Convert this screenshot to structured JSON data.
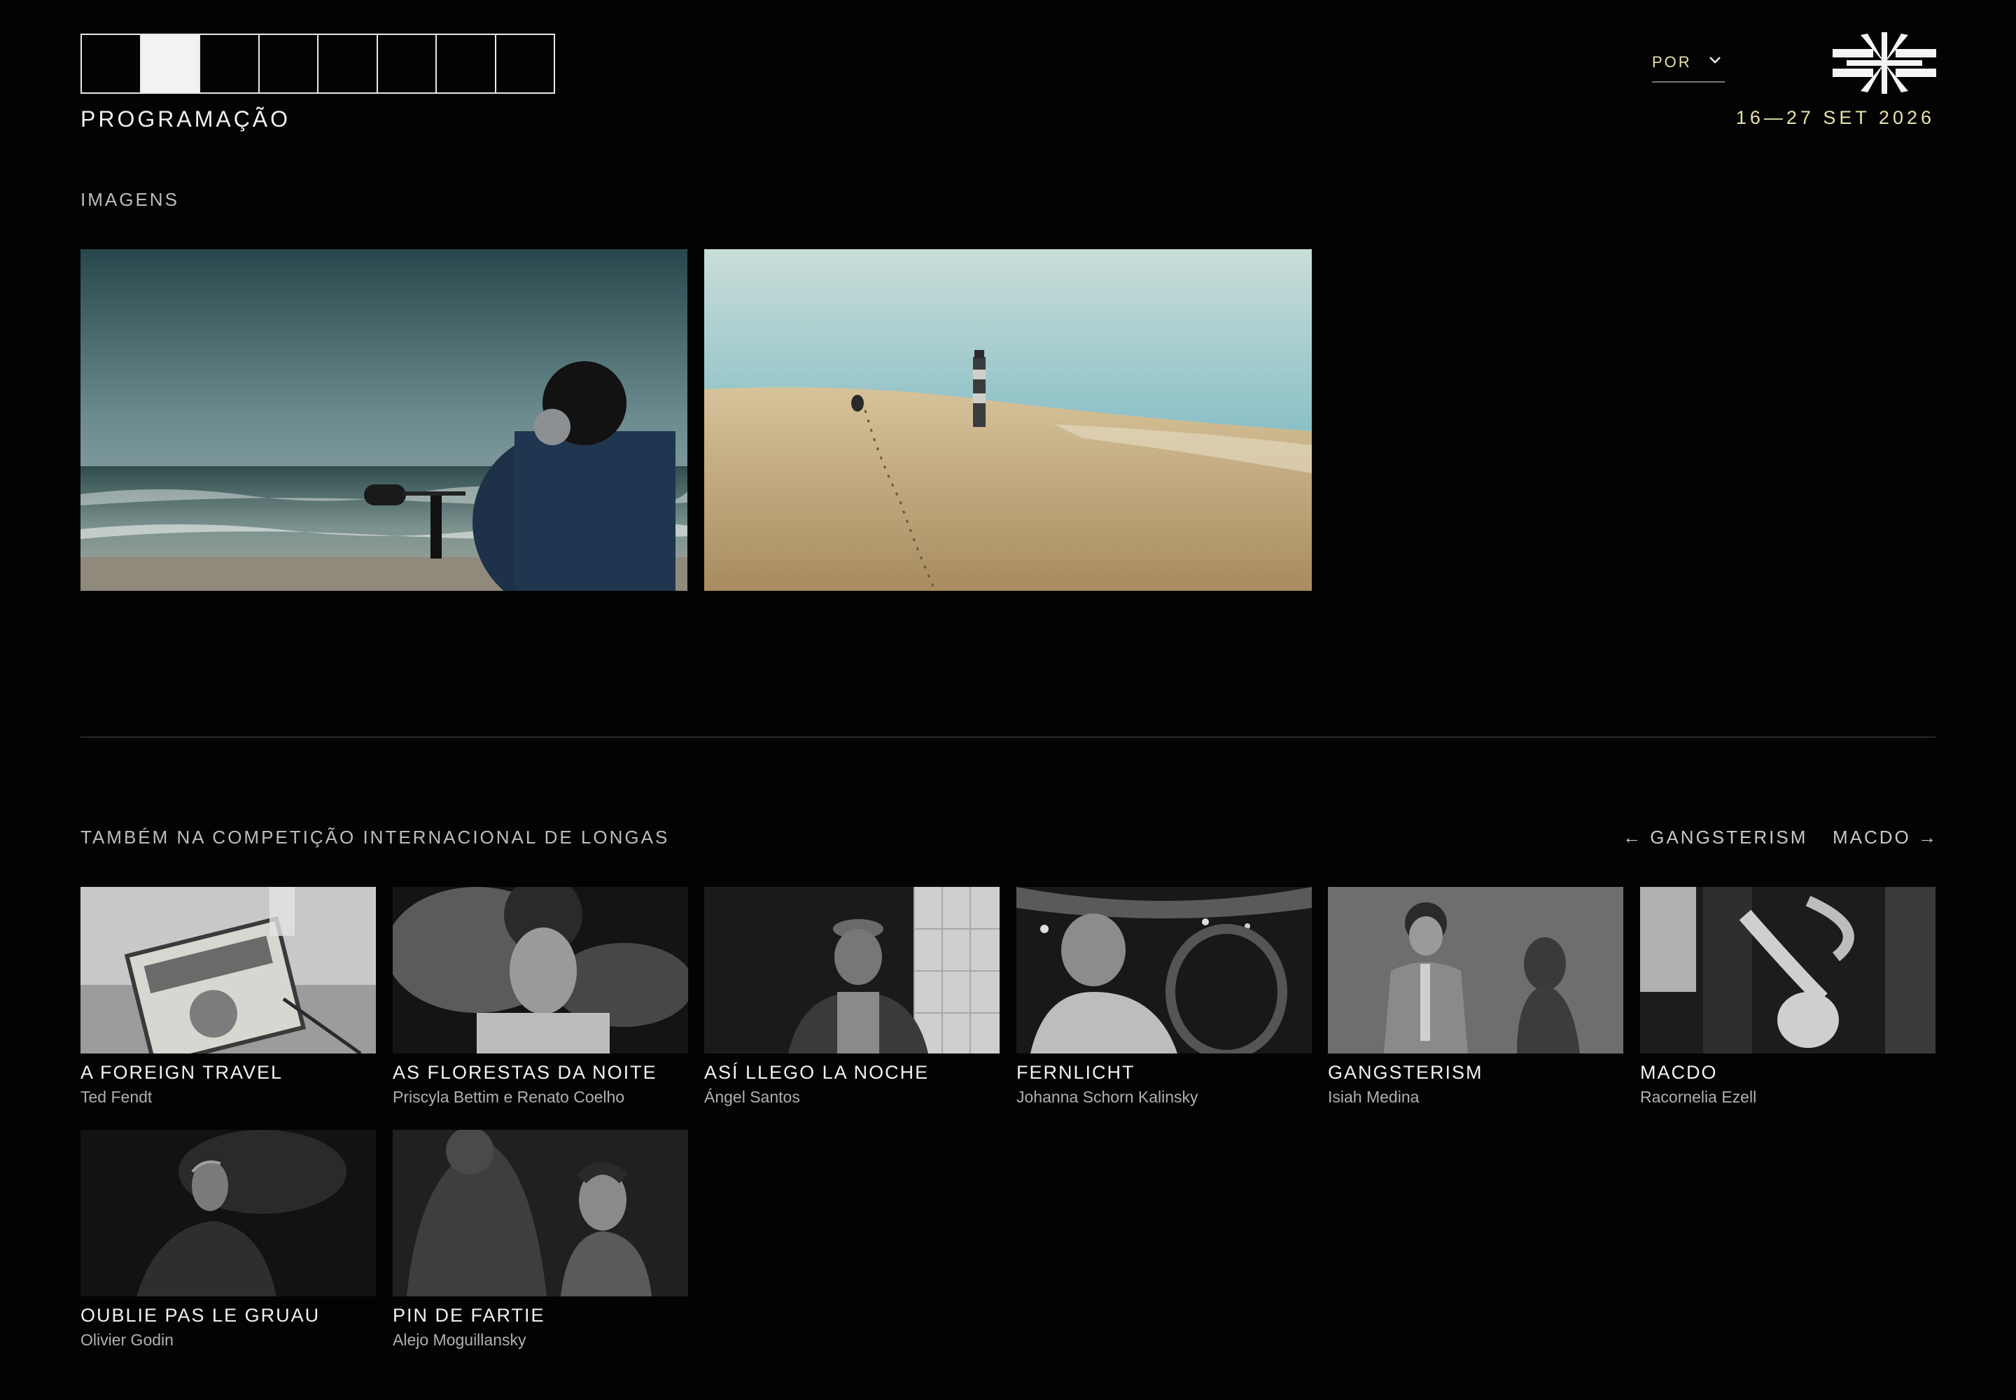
{
  "header": {
    "section_title": "PROGRAMAÇÃO",
    "language": "POR",
    "dates": "16—27 SET 2026",
    "accent_color": "#e8e3a8"
  },
  "gallery": {
    "heading": "IMAGENS",
    "images": [
      {
        "icon": "beach-sound-recordist-image"
      },
      {
        "icon": "dune-lighthouse-image"
      }
    ]
  },
  "related": {
    "heading": "TAMBÉM NA COMPETIÇÃO INTERNACIONAL DE LONGAS",
    "prev_label": "← GANGSTERISM",
    "next_label": "MACDO →",
    "films": [
      {
        "title": "A FOREIGN TRAVEL",
        "director": "Ted Fendt"
      },
      {
        "title": "AS FLORESTAS DA NOITE",
        "director": "Priscyla Bettim e Renato Coelho"
      },
      {
        "title": "ASÍ LLEGO LA NOCHE",
        "director": "Ángel Santos"
      },
      {
        "title": "FERNLICHT",
        "director": "Johanna Schorn Kalinsky"
      },
      {
        "title": "GANGSTERISM",
        "director": "Isiah Medina"
      },
      {
        "title": "MACDO",
        "director": "Racornelia Ezell"
      },
      {
        "title": "OUBLIE PAS LE GRUAU",
        "director": "Olivier Godin"
      },
      {
        "title": "PIN DE FARTIE",
        "director": "Alejo Moguillansky"
      }
    ]
  }
}
